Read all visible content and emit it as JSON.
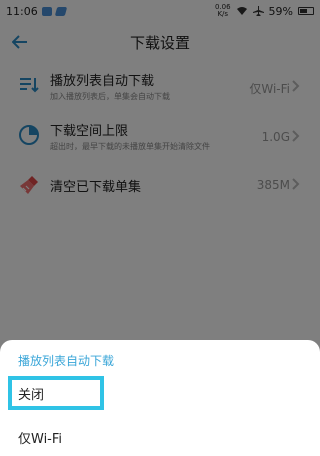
{
  "status": {
    "time": "11:06",
    "net_value": "0.06",
    "net_unit": "K/s",
    "battery": "59%",
    "battery_level": 0.59
  },
  "appbar": {
    "title": "下载设置",
    "back_icon": "arrow-left-icon"
  },
  "settings": [
    {
      "icon": "playlist-download-icon",
      "title": "播放列表自动下载",
      "desc": "加入播放列表后，单集会自动下载",
      "value": "仅Wi-Fi"
    },
    {
      "icon": "pie-chart-icon",
      "title": "下载空间上限",
      "desc": "超出时，最早下载的未播放单集开始清除文件",
      "value": "1.0G"
    },
    {
      "icon": "broom-icon",
      "title": "清空已下载单集",
      "desc": "",
      "value": "385M"
    }
  ],
  "sheet": {
    "title": "播放列表自动下载",
    "options": [
      {
        "label": "关闭"
      },
      {
        "label": "仅Wi-Fi"
      }
    ]
  },
  "colors": {
    "accent": "#3aa6d8",
    "highlight": "#2fc3e6"
  }
}
